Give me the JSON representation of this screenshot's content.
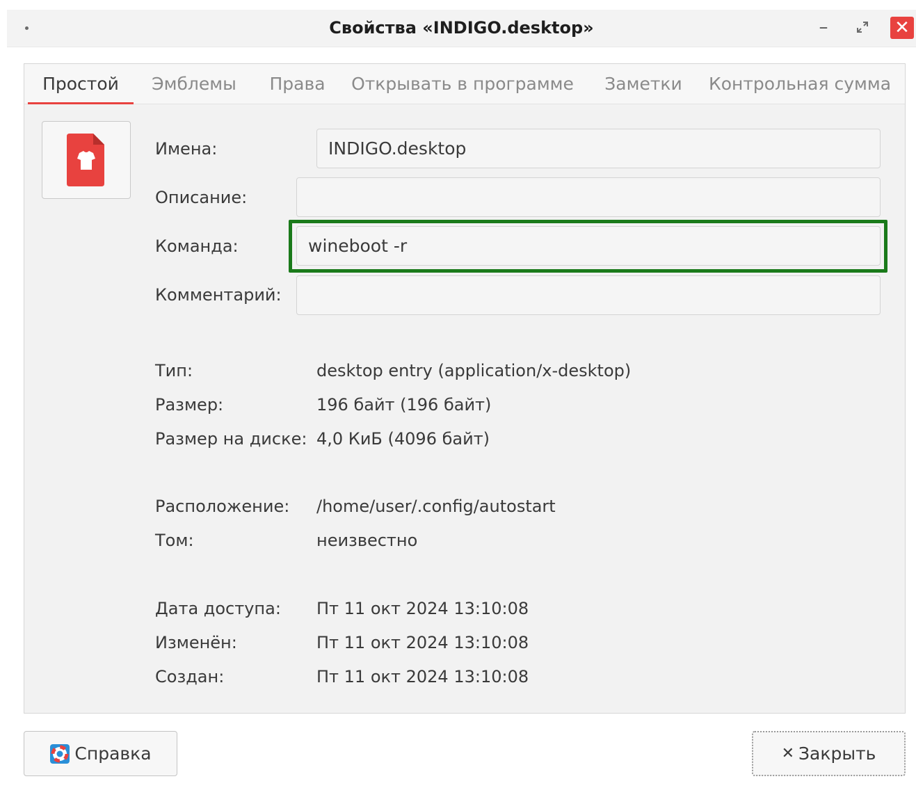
{
  "window": {
    "title": "Свойства «INDIGO.desktop»",
    "minimize_glyph": "–",
    "close_glyph": "✕"
  },
  "tabs": [
    {
      "label": "Простой",
      "active": true
    },
    {
      "label": "Эмблемы",
      "active": false
    },
    {
      "label": "Права",
      "active": false
    },
    {
      "label": "Открывать в программе",
      "active": false
    },
    {
      "label": "Заметки",
      "active": false
    },
    {
      "label": "Контрольная сумма",
      "active": false
    }
  ],
  "file_icon": "red-document-tshirt-icon",
  "form": {
    "name_label": "Имена:",
    "name_value": "INDIGO.desktop",
    "description_label": "Описание:",
    "description_value": "",
    "command_label": "Команда:",
    "command_value": "wineboot -r",
    "comment_label": "Комментарий:",
    "comment_value": ""
  },
  "info": {
    "type_label": "Тип:",
    "type_value": "desktop entry (application/x-desktop)",
    "size_label": "Размер:",
    "size_value": "196 байт (196 байт)",
    "disk_size_label": "Размер на диске:",
    "disk_size_value": "4,0 КиБ (4096 байт)",
    "location_label": "Расположение:",
    "location_value": "/home/user/.config/autostart",
    "volume_label": "Том:",
    "volume_value": "неизвестно",
    "accessed_label": "Дата доступа:",
    "accessed_value": "Пт 11 окт 2024 13:10:08",
    "modified_label": "Изменён:",
    "modified_value": "Пт 11 окт 2024 13:10:08",
    "created_label": "Создан:",
    "created_value": "Пт 11 окт 2024 13:10:08"
  },
  "buttons": {
    "help_label": "Справка",
    "close_label": "Закрыть",
    "close_glyph": "✕"
  },
  "colors": {
    "accent": "#e8423f",
    "highlight": "#1a7a1a"
  }
}
